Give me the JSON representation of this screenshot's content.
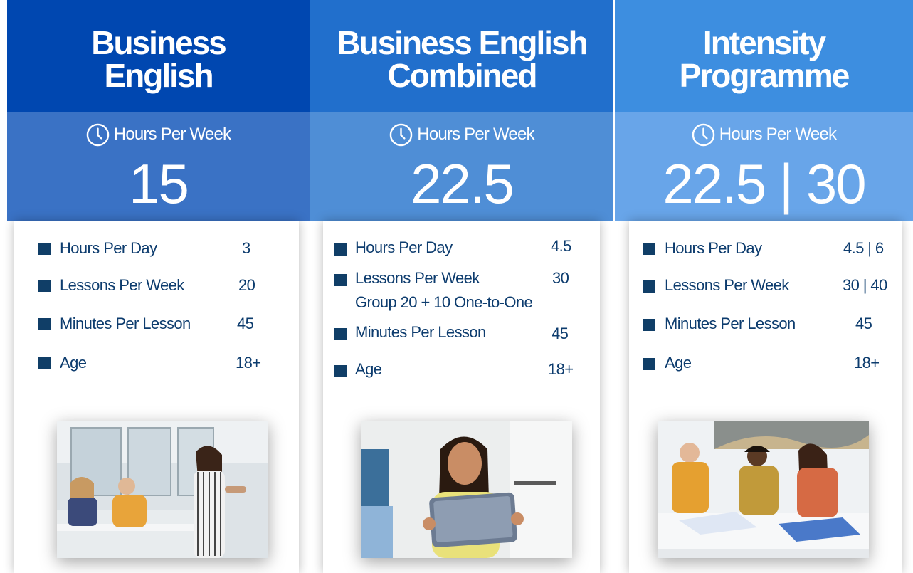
{
  "programmes": [
    {
      "title_line1": "Business",
      "title_line2": "English",
      "hours_label": "Hours Per Week",
      "hours_value": "15",
      "details": [
        {
          "label": "Hours Per Day",
          "value": "3"
        },
        {
          "label": "Lessons Per Week",
          "value": "20"
        },
        {
          "label": "Minutes Per Lesson",
          "value": "45"
        },
        {
          "label": "Age",
          "value": "18+"
        }
      ]
    },
    {
      "title_line1": "Business English",
      "title_line2": "Combined",
      "hours_label": "Hours Per Week",
      "hours_value": "22.5",
      "details": [
        {
          "label": "Hours Per Day",
          "value": "4.5"
        },
        {
          "label": "Lessons Per Week",
          "value": "30"
        },
        {
          "label": "Minutes Per Lesson",
          "value": "45"
        },
        {
          "label": "Age",
          "value": "18+"
        }
      ],
      "lessons_breakdown": "Group   20 + 10  One-to-One"
    },
    {
      "title_line1": "Intensity",
      "title_line2": "Programme",
      "hours_label": "Hours Per Week",
      "hours_value": "22.5 | 30",
      "details": [
        {
          "label": "Hours Per Day",
          "value": "4.5 | 6"
        },
        {
          "label": "Lessons Per Week",
          "value": "30 | 40"
        },
        {
          "label": "Minutes Per Lesson",
          "value": "45"
        },
        {
          "label": "Age",
          "value": "18+"
        }
      ]
    }
  ],
  "icons": {
    "hours": "clock-icon",
    "bullet": "square-bullet-icon"
  },
  "colors": {
    "col1_title": "#0047b0",
    "col1_hours": "#3a72c5",
    "col2_title": "#216fcc",
    "col2_hours": "#4f8ed6",
    "col3_title": "#3d8ee0",
    "col3_hours": "#68a5e9",
    "text_dark": "#0d3c6e"
  }
}
